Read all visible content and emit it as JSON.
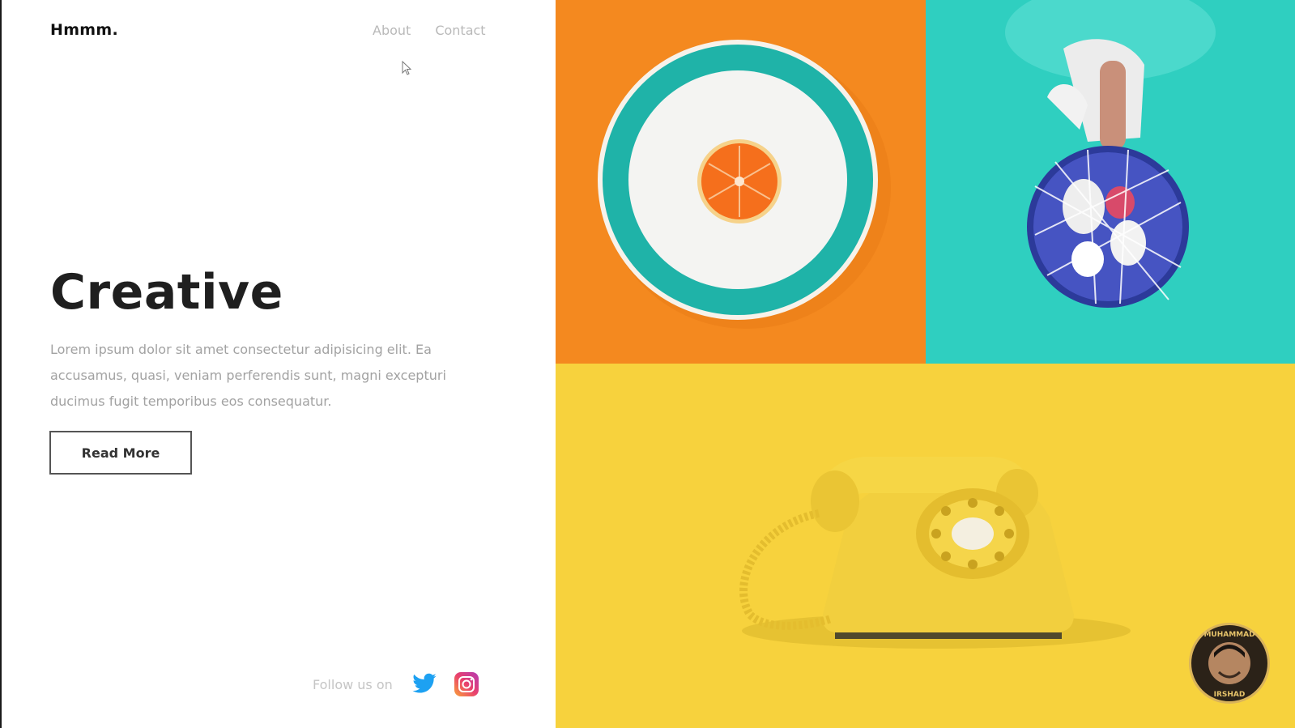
{
  "header": {
    "logo": "Hmmm.",
    "nav": [
      {
        "label": "About"
      },
      {
        "label": "Contact"
      }
    ]
  },
  "hero": {
    "title": "Creative",
    "text": "Lorem ipsum dolor sit amet consectetur adipisicing elit. Ea accusamus, quasi, veniam perferendis sunt, magni excepturi ducimus fugit temporibus eos consequatur.",
    "button_label": "Read More"
  },
  "footer": {
    "follow_label": "Follow us on",
    "social": [
      "twitter-icon",
      "instagram-icon"
    ]
  },
  "tiles": {
    "orange_color": "#f4891f",
    "teal_color": "#2fcfc0",
    "yellow_color": "#f7d23d"
  },
  "watermark": {
    "name": "MUHAMMAD IRSHAD"
  }
}
